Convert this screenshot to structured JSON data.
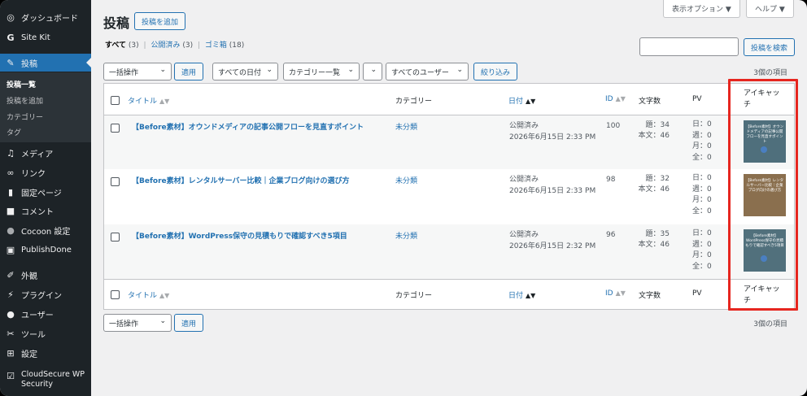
{
  "sidebar": {
    "dashboard": "ダッシュボード",
    "sitekit": "Site Kit",
    "posts": "投稿",
    "sub_all": "投稿一覧",
    "sub_add": "投稿を追加",
    "sub_cat": "カテゴリー",
    "sub_tag": "タグ",
    "media": "メディア",
    "links": "リンク",
    "pages": "固定ページ",
    "comments": "コメント",
    "cocoon": "Cocoon 設定",
    "publishdone": "PublishDone",
    "appearance": "外観",
    "plugins": "プラグイン",
    "users": "ユーザー",
    "tools": "ツール",
    "settings": "設定",
    "cloudsecure_1": "CloudSecure WP",
    "cloudsecure_2": "Security"
  },
  "header": {
    "title": "投稿",
    "add_new": "投稿を追加",
    "screen_options": "表示オプション ▼",
    "help": "ヘルプ ▼"
  },
  "filters": {
    "all": "すべて",
    "all_count": "(3)",
    "published": "公開済み",
    "published_count": "(3)",
    "trash": "ゴミ箱",
    "trash_count": "(18)",
    "search_button": "投稿を検索",
    "bulk_action": "一括操作",
    "apply": "適用",
    "all_dates": "すべての日付",
    "all_categories": "カテゴリー一覧",
    "all_users": "すべてのユーザー",
    "filter": "絞り込み",
    "items_count": "3個の項目"
  },
  "table": {
    "columns": {
      "title": "タイトル",
      "category": "カテゴリー",
      "date": "日付",
      "id": "ID",
      "chars": "文字数",
      "pv": "PV",
      "eyecatch_1": "アイキャッ",
      "eyecatch_2": "チ"
    },
    "rows": [
      {
        "title": "【Before素材】オウンドメディアの記事公開フローを見直すポイント",
        "category": "未分類",
        "status": "公開済み",
        "date": "2026年6月15日 2:33 PM",
        "id": "100",
        "heading": "題：34",
        "body": "本文：46",
        "pv_day": "日：0",
        "pv_week": "週：0",
        "pv_month": "月：0",
        "pv_all": "全：0",
        "thumb_text": "【Before素材】オウンドメディアの記事公開フローを見直すポイント"
      },
      {
        "title": "【Before素材】レンタルサーバー比較｜企業ブログ向けの選び方",
        "category": "未分類",
        "status": "公開済み",
        "date": "2026年6月15日 2:33 PM",
        "id": "98",
        "heading": "題：32",
        "body": "本文：46",
        "pv_day": "日：0",
        "pv_week": "週：0",
        "pv_month": "月：0",
        "pv_all": "全：0",
        "thumb_text": "【Before素材】レンタルサーバー比較｜企業ブログ向けの選び方"
      },
      {
        "title": "【Before素材】WordPress保守の見積もりで確認すべき5項目",
        "category": "未分類",
        "status": "公開済み",
        "date": "2026年6月15日 2:32 PM",
        "id": "96",
        "heading": "題：35",
        "body": "本文：46",
        "pv_day": "日：0",
        "pv_week": "週：0",
        "pv_month": "月：0",
        "pv_all": "全：0",
        "thumb_text": "【Before素材】WordPress保守の見積もりで確認すべき5項目"
      }
    ]
  },
  "colors": {
    "accent": "#2271b1",
    "sidebar_bg": "#1d2327",
    "highlight": "#e6261f"
  }
}
